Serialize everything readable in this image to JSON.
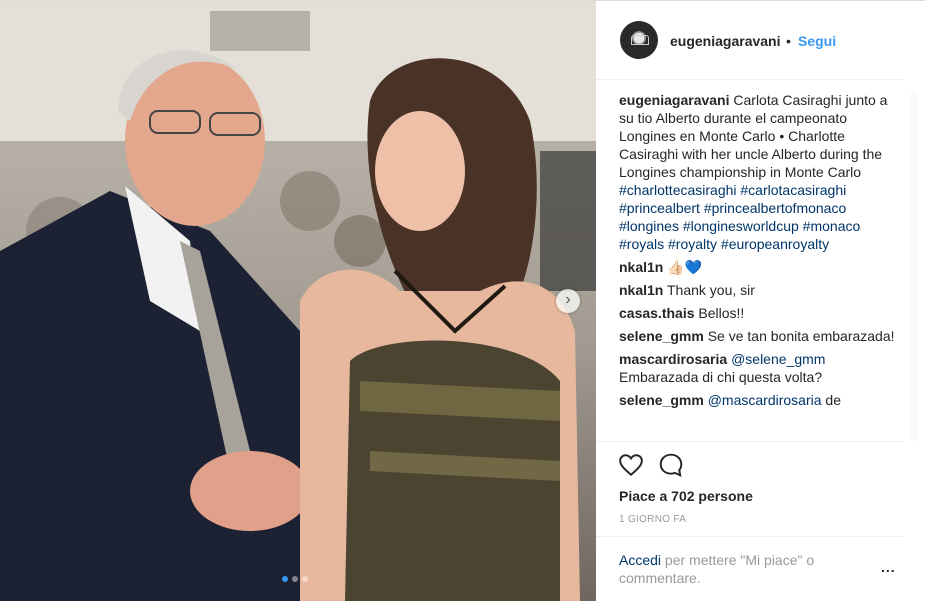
{
  "post": {
    "username": "eugeniagaravani",
    "separator": "•",
    "follow_label": "Segui",
    "caption": {
      "user": "eugeniagaravani",
      "text": "Carlota Casiraghi junto a su tio Alberto durante el campeonato Longines en Monte Carlo • Charlotte Casiraghi with her uncle Alberto during the Longines championship in Monte Carlo",
      "tags": "#charlottecasiraghi #carlotacasiraghi #princealbert #princealbertofmonaco #longines #longinesworldcup #monaco #royals #royalty #europeanroyalty"
    },
    "comments": [
      {
        "user": "nkal1n",
        "text": "👍🏻💙"
      },
      {
        "user": "nkal1n",
        "text": "Thank you, sir"
      },
      {
        "user": "casas.thais",
        "text": "Bellos!!"
      },
      {
        "user": "selene_gmm",
        "text": "Se ve tan bonita embarazada!"
      },
      {
        "user": "mascardirosaria",
        "mention": "@selene_gmm",
        "text": "Embarazada di chi questa volta?"
      },
      {
        "user": "selene_gmm",
        "mention": "@mascardirosaria",
        "text": "de"
      }
    ],
    "likes_text": "Piace a 702 persone",
    "timestamp": "1 GIORNO FA",
    "login_link": "Accedi",
    "login_text": "per mettere \"Mi piace\" o commentare.",
    "more_label": "...",
    "next_arrow": "›",
    "carousel": {
      "slides": 3,
      "active": 1
    }
  },
  "colors": {
    "link_blue": "#3897f0",
    "tag_blue": "#003569",
    "muted": "#999999"
  }
}
